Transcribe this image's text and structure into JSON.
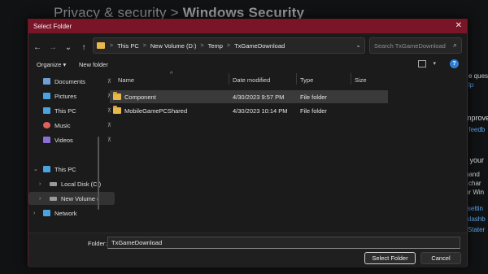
{
  "background": {
    "title_part1": "Privacy & security",
    "title_sep": ">",
    "title_part2": "Windows Security",
    "right_fragments": [
      "e quest",
      "lp",
      "mprove",
      "s feedb",
      "e your",
      "hand",
      "char",
      "ur Win",
      "r settin",
      "r dashb",
      "r Stater"
    ]
  },
  "dialog": {
    "title": "Select Folder",
    "close_glyph": "✕",
    "nav": {
      "back": "←",
      "forward": "→",
      "recent": "⌄",
      "up": "↑"
    },
    "breadcrumb": [
      "This PC",
      "New Volume (D:)",
      "Temp",
      "TxGameDownload"
    ],
    "breadcrumb_sep": ">",
    "address_chevron": "⌄",
    "refresh_glyph": "↻",
    "search_placeholder": "Search TxGameDownload",
    "search_glyph": "⌕",
    "toolbar": {
      "organize": "Organize ▾",
      "new_folder": "New folder",
      "view_chevron": "▾",
      "help": "?"
    },
    "nav_pane": [
      {
        "label": "Documents",
        "pinned": true,
        "color": "#6f9ed6"
      },
      {
        "label": "Pictures",
        "pinned": true,
        "color": "#4aa3e0"
      },
      {
        "label": "This PC",
        "pinned": true,
        "color": "#4aa3e0"
      },
      {
        "label": "Music",
        "pinned": true,
        "color": "#e0605a"
      },
      {
        "label": "Videos",
        "pinned": true,
        "color": "#8a6fd6"
      },
      {
        "label": "This PC",
        "expanded": true,
        "color": "#4aa3e0"
      },
      {
        "label": "Local Disk (C:)",
        "color": "#9a9a9a"
      },
      {
        "label": "New Volume (",
        "selected": true,
        "color": "#9a9a9a"
      },
      {
        "label": "Network",
        "color": "#4aa3e0"
      }
    ],
    "pin_glyph": "⊼",
    "expand_glyph": "›",
    "expanded_glyph": "⌄",
    "columns": {
      "name": "Name",
      "date": "Date modified",
      "type": "Type",
      "size": "Size",
      "sort_glyph": "^"
    },
    "rows": [
      {
        "name": "Component",
        "date": "4/30/2023 9:57 PM",
        "type": "File folder",
        "selected": true
      },
      {
        "name": "MobileGamePCShared",
        "date": "4/30/2023 10:14 PM",
        "type": "File folder",
        "selected": false
      }
    ],
    "folder_label": "Folder:",
    "folder_value": "TxGameDownload",
    "select_button": "Select Folder",
    "cancel_button": "Cancel"
  }
}
